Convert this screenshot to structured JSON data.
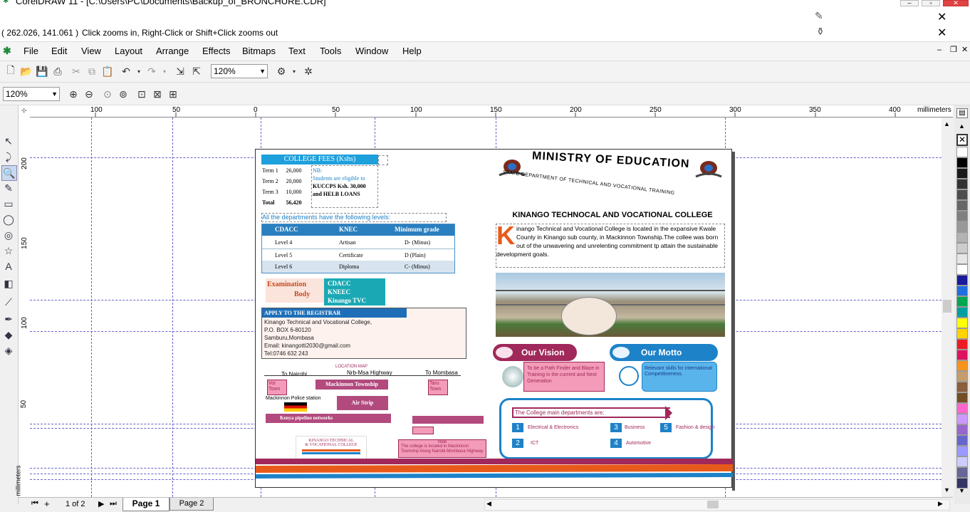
{
  "window": {
    "title": "CorelDRAW 11 - [C:\\Users\\PC\\Documents\\Backup_of_BRONCHURE.CDR]",
    "coords": "( 262.026, 141.061 )",
    "hint": "Click zooms in, Right-Click or Shift+Click zooms out"
  },
  "menu": [
    "File",
    "Edit",
    "View",
    "Layout",
    "Arrange",
    "Effects",
    "Bitmaps",
    "Text",
    "Tools",
    "Window",
    "Help"
  ],
  "toolbar": {
    "zoom_main": "120%",
    "zoom_prop": "120%"
  },
  "ruler": {
    "h_ticks": [
      "100",
      "50",
      "0",
      "50",
      "100",
      "150",
      "200",
      "250",
      "300",
      "350",
      "400"
    ],
    "unit": "millimeters",
    "v_ticks": [
      "200",
      "150",
      "100",
      "50"
    ],
    "v_unit": "millimeters"
  },
  "pages": {
    "counter": "1 of 2",
    "tabs": [
      "Page 1",
      "Page 2"
    ]
  },
  "brochure": {
    "fees": {
      "title": "COLLEGE FEES (Kshs)",
      "rows": [
        [
          "Term 1",
          "26,000"
        ],
        [
          "Term 2",
          "20,000"
        ],
        [
          "Term 3",
          "10,000"
        ],
        [
          "Total",
          "56,420"
        ]
      ],
      "nb_label": "NB:",
      "nb_line1": "Students are eligible to",
      "nb_line2": "KUCCPS Ksh. 30,000",
      "nb_line3": "and HELB LOANS"
    },
    "levels_intro": "All the departments have the following levels:",
    "levels_table": {
      "headers": [
        "CDACC",
        "KNEC",
        "Minimum grade"
      ],
      "rows": [
        [
          "Level 4",
          "Artisan",
          "D- (Minus)"
        ],
        [
          "Level 5",
          "Certificate",
          "D (Plain)"
        ],
        [
          "Level 6",
          "Diploma",
          "C- (Minus)"
        ]
      ]
    },
    "exam": {
      "label_line1": "Examination",
      "label_line2": "Body",
      "bodies": [
        "CDACC",
        "KNEEC",
        "Kinango TVC"
      ]
    },
    "apply": {
      "title": "APPLY TO THE REGISTRAR",
      "lines": [
        "Kinango Technical and Vocational College,",
        "P.O. BOX 6-80120",
        "Samburu,Mombasa",
        "Email: kinangotti2030@gmail.com",
        "Tel:0746 632 243"
      ]
    },
    "map": {
      "title": "LOCATION MAP",
      "road": "Nrb-Msa Highway",
      "to_nairobi": "To Nairobi",
      "to_mombasa": "To Mombasa",
      "voi_town": "Voi Town",
      "taru_town": "Taru Town",
      "mackinnon": "Mackinnon Township",
      "police": "Mackinnon Police station",
      "airstrip": "Air Strip",
      "pipeline": "Kenya pipeline networks",
      "note_title": "Note",
      "note_text": "The college is located in Mackinnon Township Along Nairobi-Mombasa Highway"
    },
    "footer_logo": {
      "line1": "KINANGO TECHNICAL",
      "line2": "& VOCATIONAL COLLEGE"
    },
    "ministry": "MINISTRY OF EDUCATION",
    "state_dept": "STATE DEPARTMENT OF TECHNICAL AND VOCATIONAL TRAINING",
    "college_name": "KINANGO TECHNOCAL AND VOCATIONAL COLLEGE",
    "intro": {
      "dropcap": "K",
      "text": "inango Technical and Vocational College is located in the expansive Kwale County in Kinango sub county, in Mackinnon Township.The collee was born out of the unwavering and unrelenting commitment tp attain the sustainable development goals."
    },
    "vision": {
      "title": "Our Vision",
      "text": "To be a Path Finder and Blaze in Training in the current and Next Generation"
    },
    "motto": {
      "title": "Our Motto",
      "text": "Relevant skills for international Competitiveness."
    },
    "departments": {
      "intro": "The College main departments are;",
      "items": [
        {
          "n": "1",
          "name": "Electrical & Electronics"
        },
        {
          "n": "2",
          "name": "ICT"
        },
        {
          "n": "3",
          "name": "Business"
        },
        {
          "n": "4",
          "name": "Automotive"
        },
        {
          "n": "5",
          "name": "Fashion & design"
        }
      ]
    }
  },
  "colors": {
    "accent_blue": "#1e82c8",
    "header_blue": "#2a7fbf",
    "maroon": "#a0285a",
    "teal": "#1aa9b4",
    "pink": "#f39bb8",
    "orange": "#e85a1a"
  },
  "palette": [
    "#ffffff",
    "#000000",
    "#1a1a1a",
    "#333333",
    "#4d4d4d",
    "#666666",
    "#808080",
    "#999999",
    "#b3b3b3",
    "#cccccc",
    "#e6e6e6",
    "#ffffff",
    "#1a1a9a",
    "#1e6fe0",
    "#00a651",
    "#00a0a0",
    "#ffff00",
    "#ffd200",
    "#ed1c24",
    "#e0115f",
    "#f7941d",
    "#c69c6d",
    "#8b5e3c",
    "#754c24",
    "#ff66cc",
    "#cc99ff",
    "#9966cc",
    "#6666cc",
    "#9999ff",
    "#ccccff",
    "#666699",
    "#333366"
  ]
}
